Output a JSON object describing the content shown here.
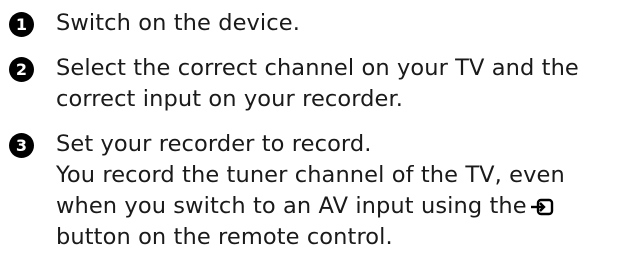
{
  "steps": [
    {
      "number": "1",
      "lines": [
        "Switch on the device."
      ]
    },
    {
      "number": "2",
      "lines": [
        "Select the correct channel on your TV and the",
        "correct input on your recorder."
      ]
    },
    {
      "number": "3",
      "lines": [
        "Set your recorder to record.",
        "You record the tuner channel of the TV, even",
        "when you switch to an AV input using the",
        "button on the remote control."
      ],
      "inline_icon": "av-input-icon"
    }
  ]
}
